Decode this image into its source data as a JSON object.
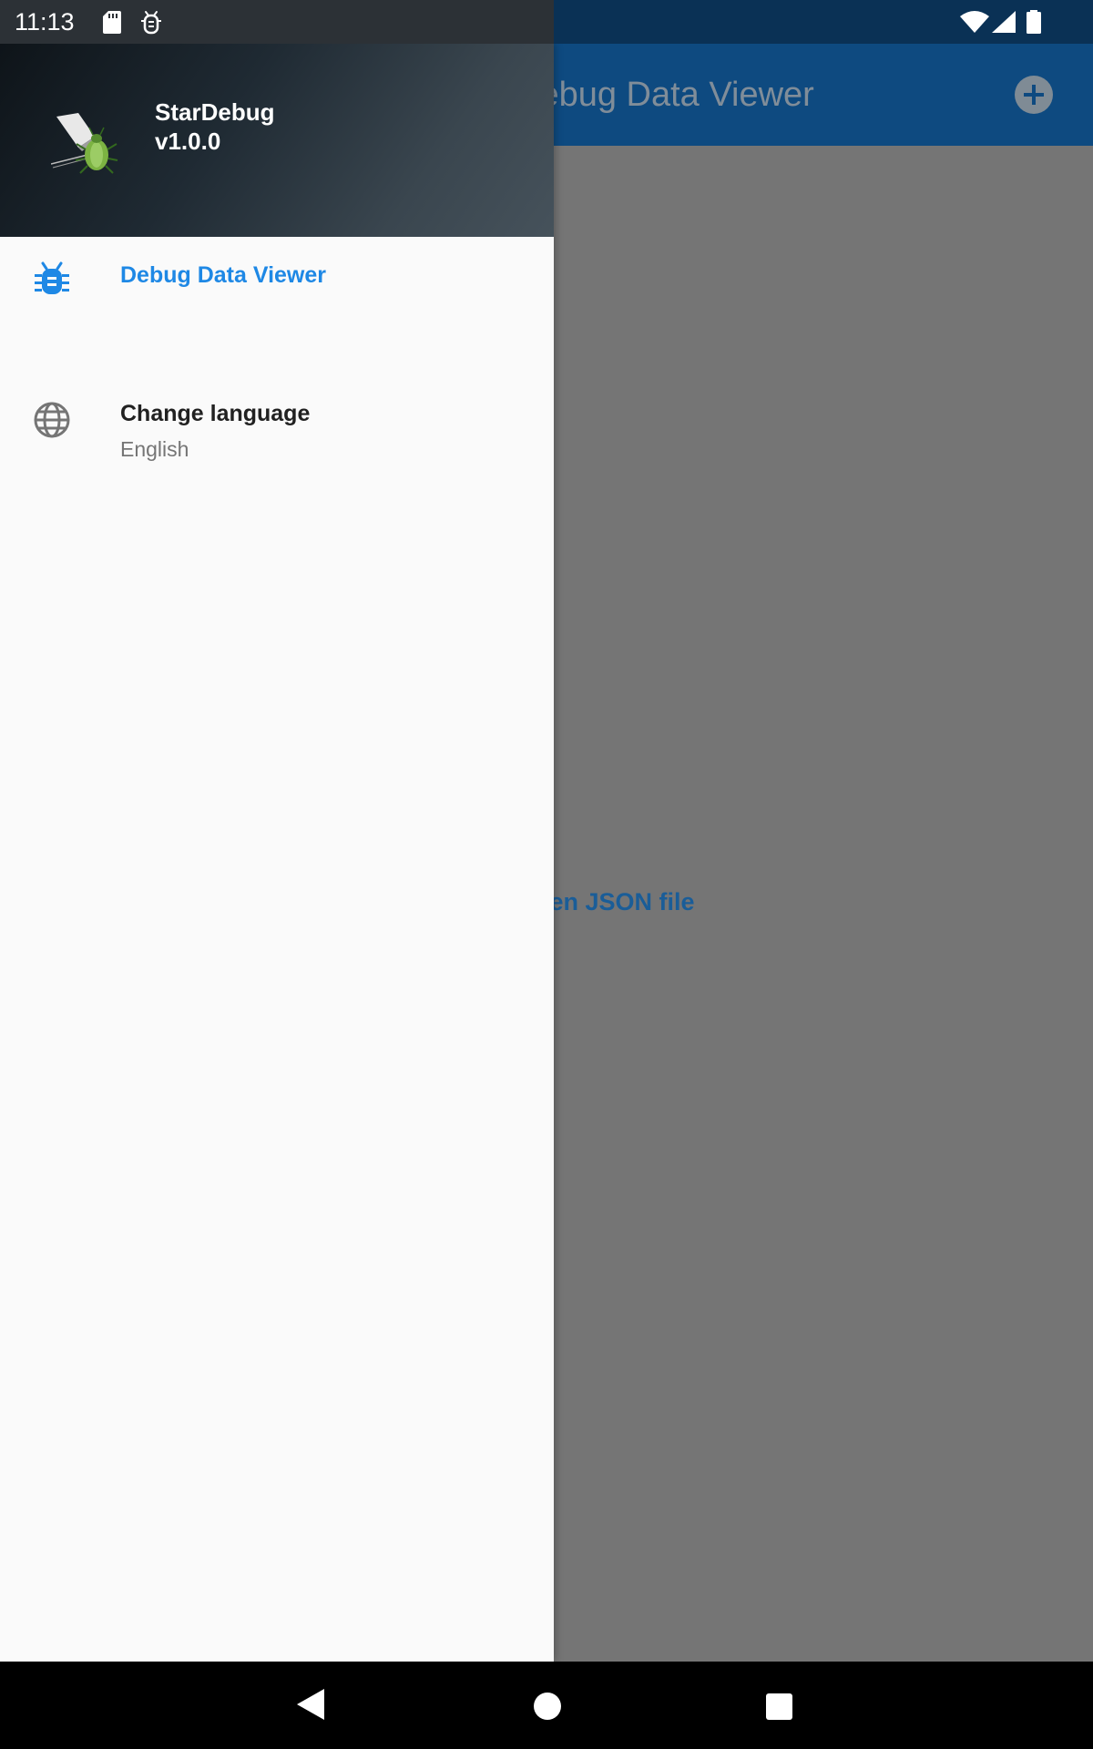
{
  "status_bar": {
    "time": "11:13",
    "icons": [
      "sd-card-icon",
      "debug-icon",
      "wifi-icon",
      "signal-icon",
      "battery-icon"
    ]
  },
  "app_bar": {
    "title": "Debug Data Viewer",
    "action_icon": "add-circle-icon"
  },
  "main": {
    "open_link": "Open JSON file"
  },
  "drawer": {
    "header": {
      "app_name": "StarDebug",
      "version": "v1.0.0",
      "logo_icon": "stardebug-logo-icon"
    },
    "items": [
      {
        "label": "Debug Data Viewer",
        "icon": "bug-icon",
        "selected": true
      },
      {
        "label": "Change language",
        "subtitle": "English",
        "icon": "globe-icon",
        "selected": false
      }
    ]
  },
  "colors": {
    "accent": "#1E88E5",
    "app_bar": "#0E4A80",
    "scrim": "#757575",
    "drawer_bg": "#FAFAFA"
  },
  "nav_bar": {
    "buttons": [
      "back-icon",
      "home-icon",
      "recents-icon"
    ]
  }
}
